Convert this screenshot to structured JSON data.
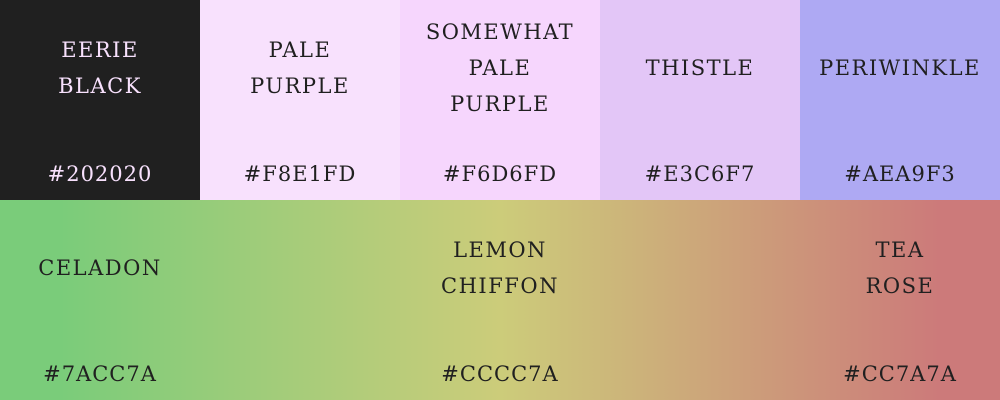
{
  "top_swatches": [
    {
      "name": "EERIE\nBLACK",
      "hex": "#202020",
      "background": "#202020",
      "text_color": "#F8E1FD"
    },
    {
      "name": "PALE\nPURPLE",
      "hex": "#F8E1FD",
      "background": "#F8E1FD",
      "text_color": "#202020"
    },
    {
      "name": "SOMEWHAT\nPALE\nPURPLE",
      "hex": "#F6D6FD",
      "background": "#F6D6FD",
      "text_color": "#202020"
    },
    {
      "name": "THISTLE",
      "hex": "#E3C6F7",
      "background": "#E3C6F7",
      "text_color": "#202020"
    },
    {
      "name": "PERIWINKLE",
      "hex": "#AEA9F3",
      "background": "#AEA9F3",
      "text_color": "#202020"
    }
  ],
  "gradient_stops": [
    {
      "name": "CELADON",
      "hex": "#7ACC7A",
      "background": "#7ACC7A",
      "text_color": "#202020"
    },
    {
      "name": "LEMON\nCHIFFON",
      "hex": "#CCCC7A",
      "background": "#CCCC7A",
      "text_color": "#202020"
    },
    {
      "name": "TEA\nROSE",
      "hex": "#CC7A7A",
      "background": "#CC7A7A",
      "text_color": "#202020"
    }
  ]
}
